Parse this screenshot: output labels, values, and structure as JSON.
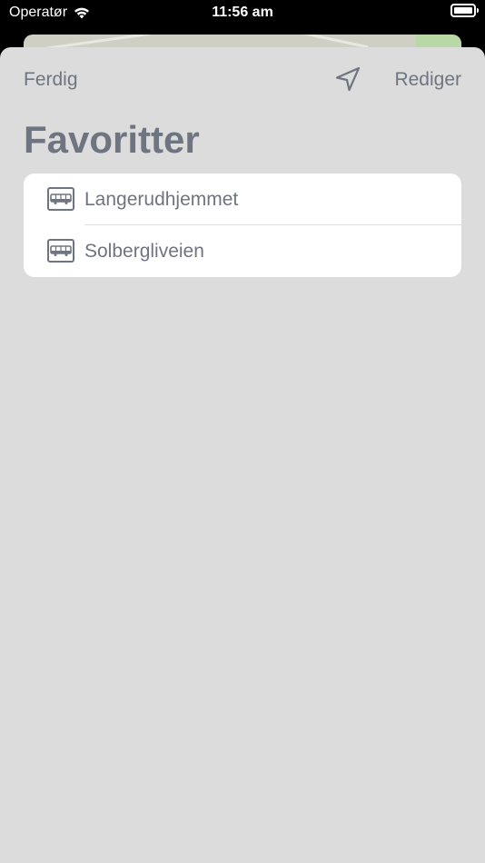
{
  "status_bar": {
    "carrier": "Operatør",
    "time": "11:56 am"
  },
  "nav": {
    "done_label": "Ferdig",
    "edit_label": "Rediger"
  },
  "page": {
    "title": "Favoritter"
  },
  "favorites": [
    {
      "name": "Langerudhjemmet",
      "icon": "bus-icon"
    },
    {
      "name": "Solbergliveien",
      "icon": "bus-icon"
    }
  ],
  "colors": {
    "accent_gray": "#6e7580",
    "sheet_background": "#dcdcdc",
    "list_background": "#ffffff"
  }
}
